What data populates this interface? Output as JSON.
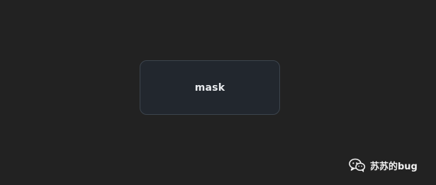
{
  "main": {
    "button_label": "mask"
  },
  "watermark": {
    "text": "苏苏的bug",
    "icon": "wechat-icon"
  },
  "colors": {
    "background": "#222222",
    "card_background": "#22272e",
    "card_border": "#3c444d",
    "text": "#e8eaed"
  }
}
